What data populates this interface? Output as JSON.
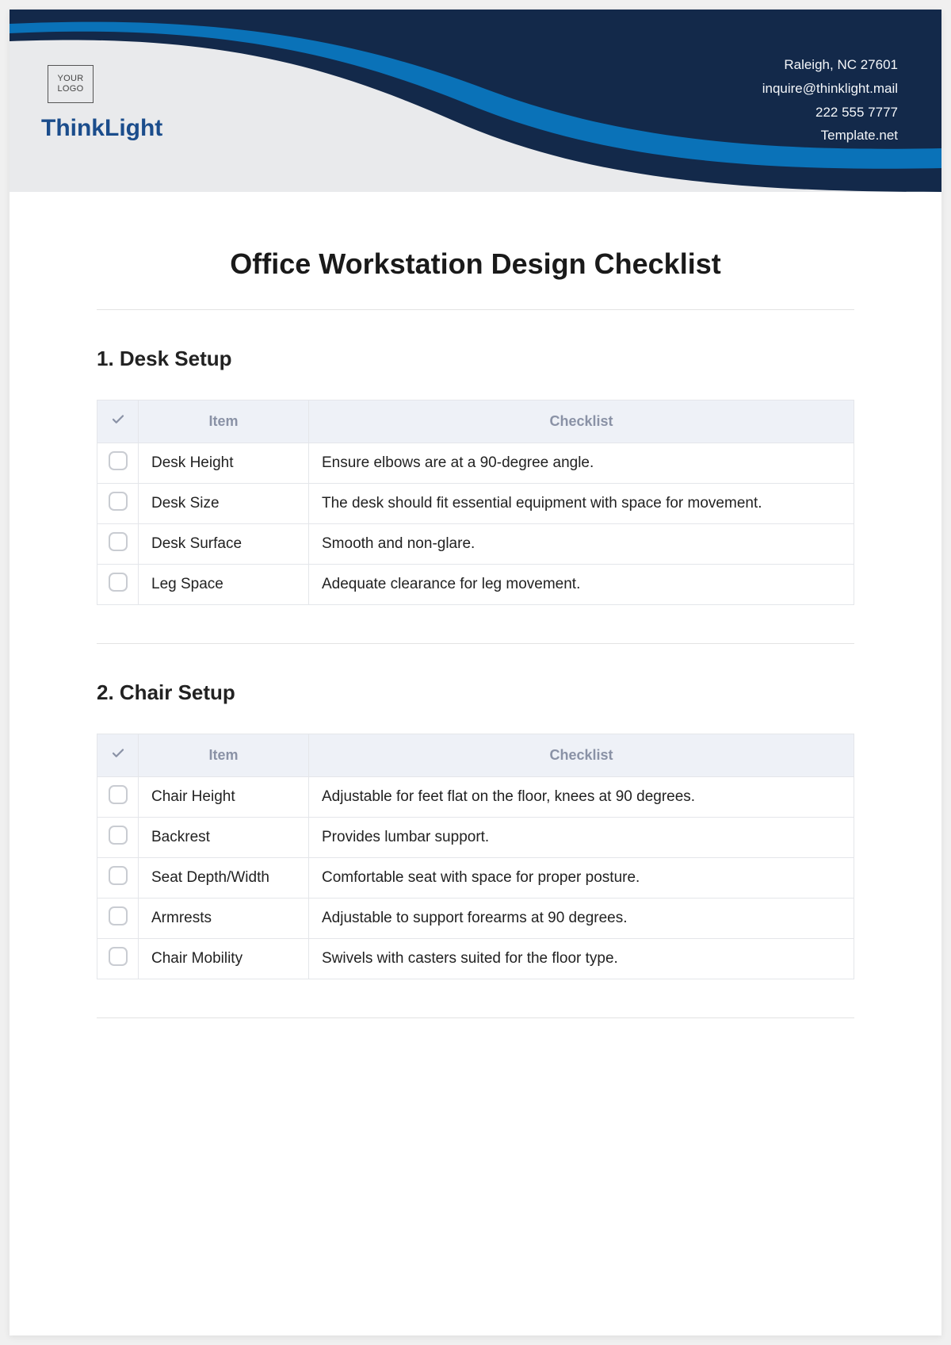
{
  "header": {
    "logo_text": "YOUR\nLOGO",
    "brand": "ThinkLight",
    "contact": {
      "address": "Raleigh, NC 27601",
      "email": "inquire@thinklight.mail",
      "phone": "222 555 7777",
      "site": "Template.net"
    }
  },
  "title": "Office Workstation Design Checklist",
  "columns": {
    "item": "Item",
    "checklist": "Checklist"
  },
  "sections": [
    {
      "heading": "1. Desk Setup",
      "rows": [
        {
          "item": "Desk Height",
          "text": "Ensure elbows are at a 90-degree angle."
        },
        {
          "item": "Desk Size",
          "text": "The desk should fit essential equipment with space for movement."
        },
        {
          "item": "Desk Surface",
          "text": "Smooth and non-glare."
        },
        {
          "item": "Leg Space",
          "text": "Adequate clearance for leg movement."
        }
      ]
    },
    {
      "heading": "2. Chair Setup",
      "rows": [
        {
          "item": "Chair Height",
          "text": "Adjustable for feet flat on the floor, knees at 90 degrees."
        },
        {
          "item": "Backrest",
          "text": "Provides lumbar support."
        },
        {
          "item": "Seat Depth/Width",
          "text": "Comfortable seat with space for proper posture."
        },
        {
          "item": "Armrests",
          "text": "Adjustable to support forearms at 90 degrees."
        },
        {
          "item": "Chair Mobility",
          "text": "Swivels with casters suited for the floor type."
        }
      ]
    }
  ]
}
